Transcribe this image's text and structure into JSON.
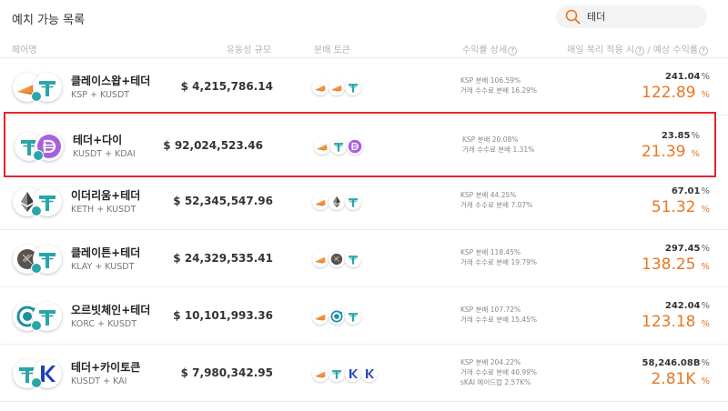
{
  "page": {
    "title": "예치 가능 목록",
    "search_value": "테더"
  },
  "header": {
    "pair": "페어명",
    "tvl": "유동성 규모",
    "dist": "분배 토큰",
    "detail": "수익률 상세",
    "apy": "매일 복리 적용 시",
    "apy_est": "/ 예상 수익률"
  },
  "colors": {
    "accent": "#e87722",
    "selection": "#e8242d",
    "tether": "#2aa5a8"
  },
  "rows": [
    {
      "name": "클레이스왑+테더",
      "sub": "KSP + KUSDT",
      "tvl": "$ 4,215,786.14",
      "icons": [
        "klayswap-icon",
        "tether-icon"
      ],
      "dist": [
        "klayswap-icon",
        "klayswap-icon",
        "tether-icon"
      ],
      "d1": "KSP 분배 106.59%",
      "d2": "거래 수수료 분배 16.29%",
      "d3": "",
      "apy_top": "241.04",
      "apy_main": "122.89"
    },
    {
      "name": "테더+다이",
      "sub": "KUSDT + KDAI",
      "tvl": "$ 92,024,523.46",
      "icons": [
        "tether-icon",
        "dai-icon"
      ],
      "dist": [
        "klayswap-icon",
        "tether-icon",
        "dai-icon"
      ],
      "d1": "KSP 분배 20.08%",
      "d2": "거래 수수료 분배 1.31%",
      "d3": "",
      "apy_top": "23.85",
      "apy_main": "21.39"
    },
    {
      "name": "이더리움+테더",
      "sub": "KETH + KUSDT",
      "tvl": "$ 52,345,547.96",
      "icons": [
        "ethereum-icon",
        "tether-icon"
      ],
      "dist": [
        "klayswap-icon",
        "ethereum-icon",
        "tether-icon"
      ],
      "d1": "KSP 분배 44.25%",
      "d2": "거래 수수료 분배 7.07%",
      "d3": "",
      "apy_top": "67.01",
      "apy_main": "51.32"
    },
    {
      "name": "클레이튼+테더",
      "sub": "KLAY + KUSDT",
      "tvl": "$ 24,329,535.41",
      "icons": [
        "klaytn-icon",
        "tether-icon"
      ],
      "dist": [
        "klayswap-icon",
        "klaytn-icon",
        "tether-icon"
      ],
      "d1": "KSP 분배 118.45%",
      "d2": "거래 수수료 분배 19.79%",
      "d3": "",
      "apy_top": "297.45",
      "apy_main": "138.25"
    },
    {
      "name": "오르빗체인+테더",
      "sub": "KORC + KUSDT",
      "tvl": "$ 10,101,993.36",
      "icons": [
        "orbit-chain-icon",
        "tether-icon"
      ],
      "dist": [
        "klayswap-icon",
        "orbit-chain-icon",
        "tether-icon"
      ],
      "d1": "KSP 분배 107.72%",
      "d2": "거래 수수료 분배 15.45%",
      "d3": "",
      "apy_top": "242.04",
      "apy_main": "123.18"
    },
    {
      "name": "테더+카이토큰",
      "sub": "KUSDT + KAI",
      "tvl": "$ 7,980,342.95",
      "icons": [
        "tether-icon",
        "kai-token-icon"
      ],
      "dist": [
        "klayswap-icon",
        "tether-icon",
        "kai-token-icon",
        "kai-token-icon"
      ],
      "d1": "KSP 분배 204.22%",
      "d2": "거래 수수료 분배 40.99%",
      "d3": "sKAI 에어드랍 2.57K%",
      "apy_top": "58,246.08B",
      "apy_main": "2.81K"
    }
  ],
  "pct_symbol": "%"
}
